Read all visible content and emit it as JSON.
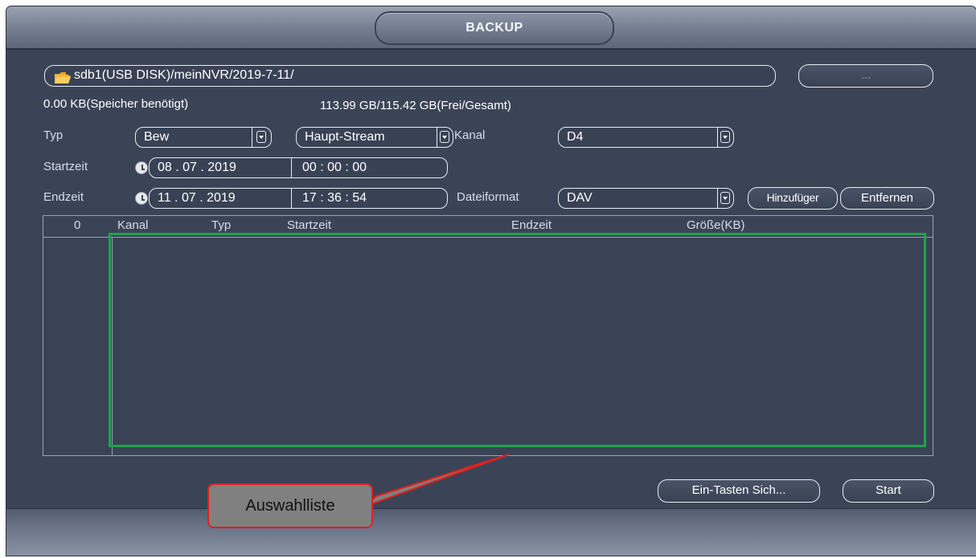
{
  "window": {
    "title": "BACKUP"
  },
  "path": {
    "value": "sdb1(USB DISK)/meinNVR/2019-7-11/",
    "browse_label": "..."
  },
  "storage": {
    "required": "0.00 KB(Speicher benötigt)",
    "free_total": "113.99 GB/115.42 GB(Frei/Gesamt)"
  },
  "form": {
    "type_label": "Typ",
    "type_value": "Bew",
    "stream_value": "Haupt-Stream",
    "channel_label": "Kanal",
    "channel_value": "D4",
    "start_label": "Startzeit",
    "start_date": "08 . 07 . 2019",
    "start_time": "00 : 00 : 00",
    "end_label": "Endzeit",
    "end_date": "11 . 07 . 2019",
    "end_time": "17 : 36 : 54",
    "format_label": "Dateiformat",
    "format_value": "DAV",
    "add_label": "Hinzufüger",
    "remove_label": "Entfernen"
  },
  "table": {
    "columns": [
      "0",
      "Kanal",
      "Typ",
      "Startzeit",
      "Endzeit",
      "Größe(KB)"
    ],
    "rows": []
  },
  "footer": {
    "onekey_label": "Ein-Tasten Sich...",
    "start_label": "Start"
  },
  "annotation": {
    "callout_text": "Auswahlliste"
  },
  "colors": {
    "panel_bg": "#3b4457",
    "highlight_border": "#1fa34a",
    "callout_border": "#e0201e",
    "callout_bg": "#808080"
  }
}
